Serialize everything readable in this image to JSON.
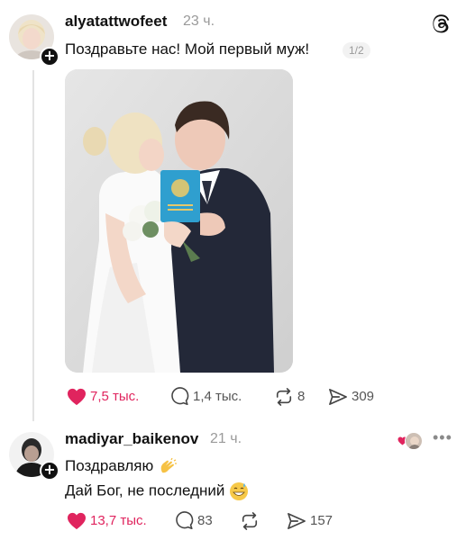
{
  "post1": {
    "username": "alyatattwofeet",
    "time": "23 ч.",
    "text": "Поздравьте нас! Мой первый муж!",
    "pager": "1/2",
    "likes": "7,5 тыс.",
    "comments": "1,4 тыс.",
    "reposts": "8",
    "shares": "309",
    "avatar_icon": "avatar-blonde-woman",
    "photo": "wedding-couple-kissing-photo"
  },
  "post2": {
    "username": "madiyar_baikenov",
    "time": "21 ч.",
    "line1": "Поздравляю",
    "line1_emoji": "clapping-hands-emoji",
    "line2": "Дай Бог, не последний",
    "line2_emoji": "grinning-sweat-emoji",
    "likes": "13,7 тыс.",
    "comments": "83",
    "shares": "157",
    "more": "•••"
  },
  "icons": {
    "app": "threads-logo-icon",
    "like": "heart-icon",
    "comment": "comment-icon",
    "repost": "repost-icon",
    "share": "send-icon",
    "follow": "plus-icon"
  },
  "colors": {
    "like_red": "#e0245e",
    "text": "#111111",
    "muted": "#9a9a9a",
    "thread_line": "#e3e3e3"
  }
}
